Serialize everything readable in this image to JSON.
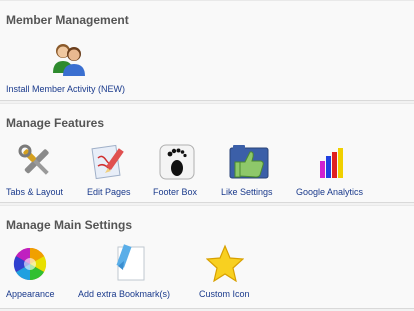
{
  "sections": [
    {
      "title": "Member Management",
      "items": [
        {
          "label": "Install Member Activity (NEW)",
          "icon": "members-icon"
        }
      ]
    },
    {
      "title": "Manage Features",
      "items": [
        {
          "label": "Tabs & Layout",
          "icon": "tools-icon"
        },
        {
          "label": "Edit Pages",
          "icon": "edit-pages-icon"
        },
        {
          "label": "Footer Box",
          "icon": "footprint-icon"
        },
        {
          "label": "Like Settings",
          "icon": "thumbs-up-icon"
        },
        {
          "label": "Google Analytics",
          "icon": "bar-chart-icon"
        }
      ]
    },
    {
      "title": "Manage Main Settings",
      "items": [
        {
          "label": "Appearance",
          "icon": "color-wheel-icon"
        },
        {
          "label": "Add extra Bookmark(s)",
          "icon": "bookmark-icon"
        },
        {
          "label": "Custom Icon",
          "icon": "star-icon"
        }
      ]
    }
  ]
}
